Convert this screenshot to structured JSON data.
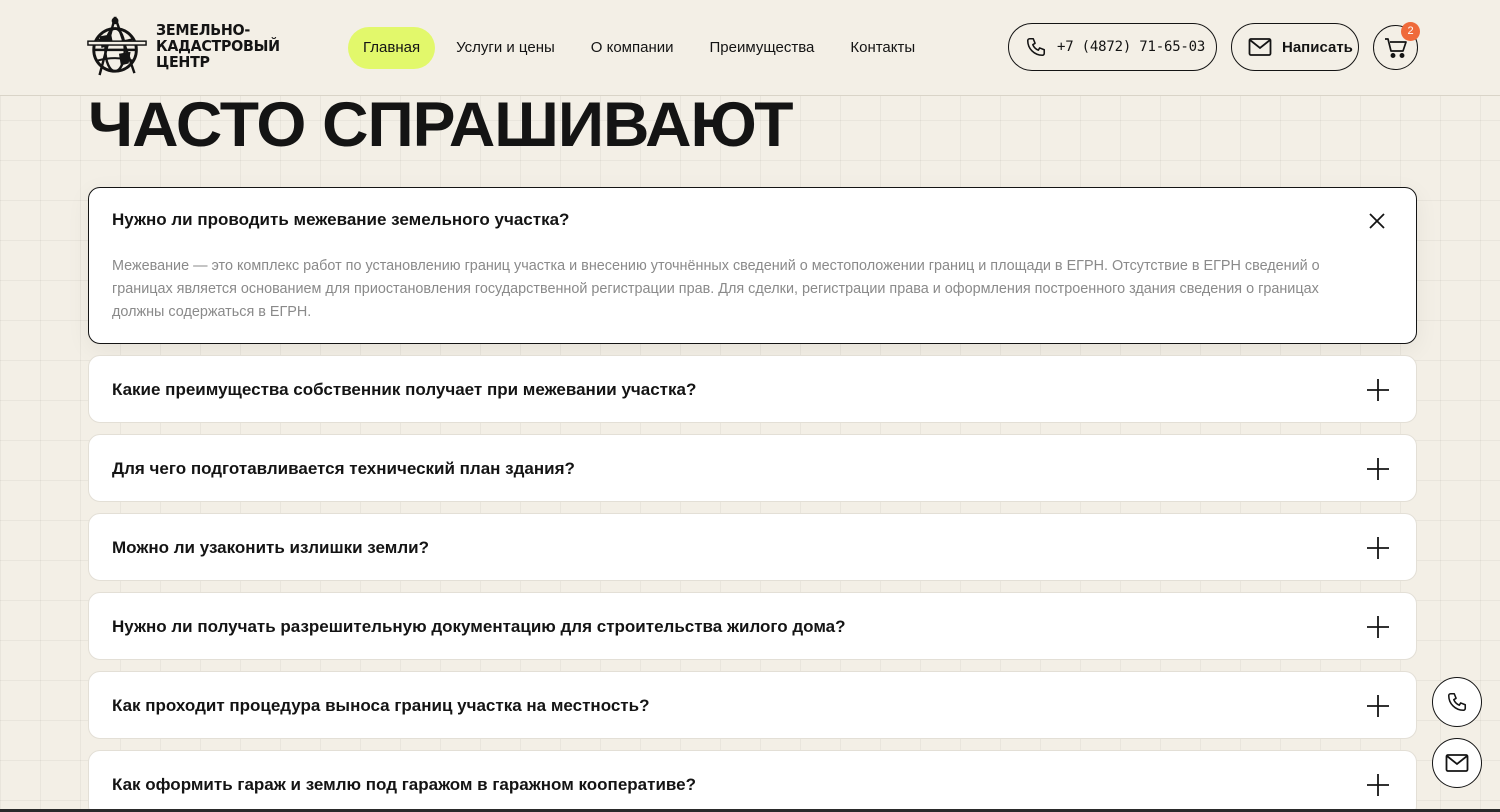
{
  "header": {
    "logo": {
      "line1": "Земельно-",
      "line2": "кадастровый",
      "line3": "центр"
    },
    "nav": [
      {
        "label": "Главная",
        "active": true
      },
      {
        "label": "Услуги и цены",
        "active": false
      },
      {
        "label": "О компании",
        "active": false
      },
      {
        "label": "Преимущества",
        "active": false
      },
      {
        "label": "Контакты",
        "active": false
      }
    ],
    "phone_label": "+7 (4872) 71-65-03",
    "write_label": "Написать",
    "cart_count": "2"
  },
  "faq": {
    "title": "ЧАСТО СПРАШИВАЮТ",
    "items": [
      {
        "question": "Нужно ли проводить межевание земельного участка?",
        "answer": "Межевание — это комплекс работ по установлению границ участка и внесению уточнённых сведений о местоположении границ и площади в ЕГРН. Отсутствие в ЕГРН сведений о границах является основанием для приостановления государственной регистрации прав. Для сделки, регистрации права и оформления построенного здания сведения о границах должны содержаться в ЕГРН.",
        "open": true
      },
      {
        "question": "Какие преимущества собственник получает при межевании участка?",
        "open": false
      },
      {
        "question": "Для чего подготавливается технический план здания?",
        "open": false
      },
      {
        "question": "Можно ли узаконить излишки земли?",
        "open": false
      },
      {
        "question": "Нужно ли получать разрешительную документацию для строительства жилого дома?",
        "open": false
      },
      {
        "question": "Как проходит процедура выноса границ участка на местность?",
        "open": false
      },
      {
        "question": "Как оформить гараж и землю под гаражом в гаражном кооперативе?",
        "open": false
      }
    ]
  },
  "colors": {
    "background": "#f3efe6",
    "accent": "#e2f86b",
    "badge": "#ef6a3a",
    "text": "#141414",
    "muted": "#8a8a8a"
  },
  "icons": {
    "phone": "phone-icon",
    "mail": "mail-icon",
    "cart": "cart-icon",
    "close": "close-icon",
    "plus": "plus-icon"
  }
}
